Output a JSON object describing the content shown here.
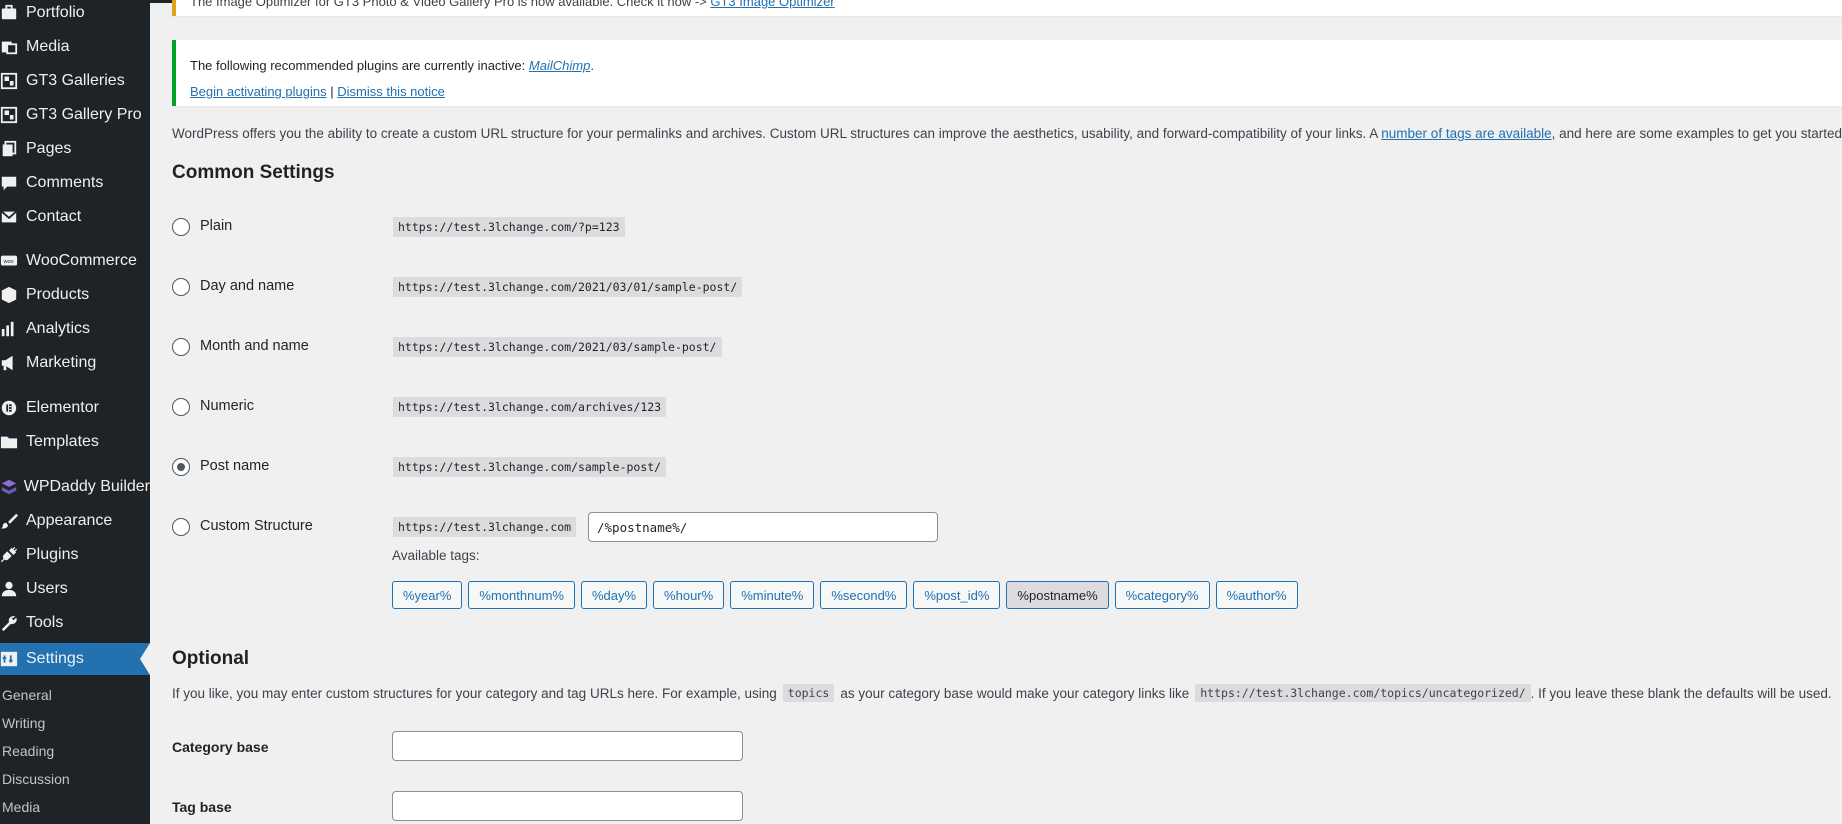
{
  "sidebar": {
    "items": [
      {
        "label": "Portfolio",
        "icon": "portfolio-icon"
      },
      {
        "label": "Media",
        "icon": "media-icon"
      },
      {
        "label": "GT3 Galleries",
        "icon": "gallery-icon"
      },
      {
        "label": "GT3 Gallery Pro",
        "icon": "gallery-icon"
      },
      {
        "label": "Pages",
        "icon": "pages-icon"
      },
      {
        "label": "Comments",
        "icon": "comments-icon"
      },
      {
        "label": "Contact",
        "icon": "mail-icon"
      },
      {
        "label": "WooCommerce",
        "icon": "woo-icon"
      },
      {
        "label": "Products",
        "icon": "products-icon"
      },
      {
        "label": "Analytics",
        "icon": "analytics-icon"
      },
      {
        "label": "Marketing",
        "icon": "megaphone-icon"
      },
      {
        "label": "Elementor",
        "icon": "elementor-icon"
      },
      {
        "label": "Templates",
        "icon": "folder-icon"
      },
      {
        "label": "WPDaddy Builder",
        "icon": "builder-icon"
      },
      {
        "label": "Appearance",
        "icon": "brush-icon"
      },
      {
        "label": "Plugins",
        "icon": "plug-icon"
      },
      {
        "label": "Users",
        "icon": "users-icon"
      },
      {
        "label": "Tools",
        "icon": "wrench-icon"
      },
      {
        "label": "Settings",
        "icon": "settings-icon"
      }
    ],
    "submenu": [
      "General",
      "Writing",
      "Reading",
      "Discussion",
      "Media"
    ],
    "active": "Settings"
  },
  "notices": {
    "top_text": "The Image Optimizer for GT3 Photo & Video Gallery Pro is now available. Check it now ->",
    "top_link": "GT3 Image Optimizer",
    "inactive_prefix": "The following recommended plugins are currently inactive:",
    "inactive_plugin": "MailChimp",
    "activate_link": "Begin activating plugins",
    "separator": "|",
    "dismiss_link": "Dismiss this notice"
  },
  "intro": {
    "text_before": "WordPress offers you the ability to create a custom URL structure for your permalinks and archives. Custom URL structures can improve the aesthetics, usability, and forward-compatibility of your links. A",
    "link": "number of tags are available",
    "text_after": ", and here are some examples to get you started."
  },
  "common": {
    "heading": "Common Settings",
    "options": [
      {
        "label": "Plain",
        "example": "https://test.3lchange.com/?p=123",
        "checked": false
      },
      {
        "label": "Day and name",
        "example": "https://test.3lchange.com/2021/03/01/sample-post/",
        "checked": false
      },
      {
        "label": "Month and name",
        "example": "https://test.3lchange.com/2021/03/sample-post/",
        "checked": false
      },
      {
        "label": "Numeric",
        "example": "https://test.3lchange.com/archives/123",
        "checked": false
      },
      {
        "label": "Post name",
        "example": "https://test.3lchange.com/sample-post/",
        "checked": true
      },
      {
        "label": "Custom Structure",
        "example": "https://test.3lchange.com",
        "checked": false
      }
    ],
    "custom_value": "/%postname%/",
    "available_tags_label": "Available tags:",
    "tags": [
      "%year%",
      "%monthnum%",
      "%day%",
      "%hour%",
      "%minute%",
      "%second%",
      "%post_id%",
      "%postname%",
      "%category%",
      "%author%"
    ],
    "active_tag": "%postname%"
  },
  "optional": {
    "heading": "Optional",
    "desc_before": "If you like, you may enter custom structures for your category and tag URLs here. For example, using",
    "desc_code1": "topics",
    "desc_mid": "as your category base would make your category links like",
    "desc_code2": "https://test.3lchange.com/topics/uncategorized/",
    "desc_after": ". If you leave these blank the defaults will be used.",
    "category_label": "Category base",
    "category_value": "",
    "tag_label": "Tag base",
    "tag_value": ""
  }
}
